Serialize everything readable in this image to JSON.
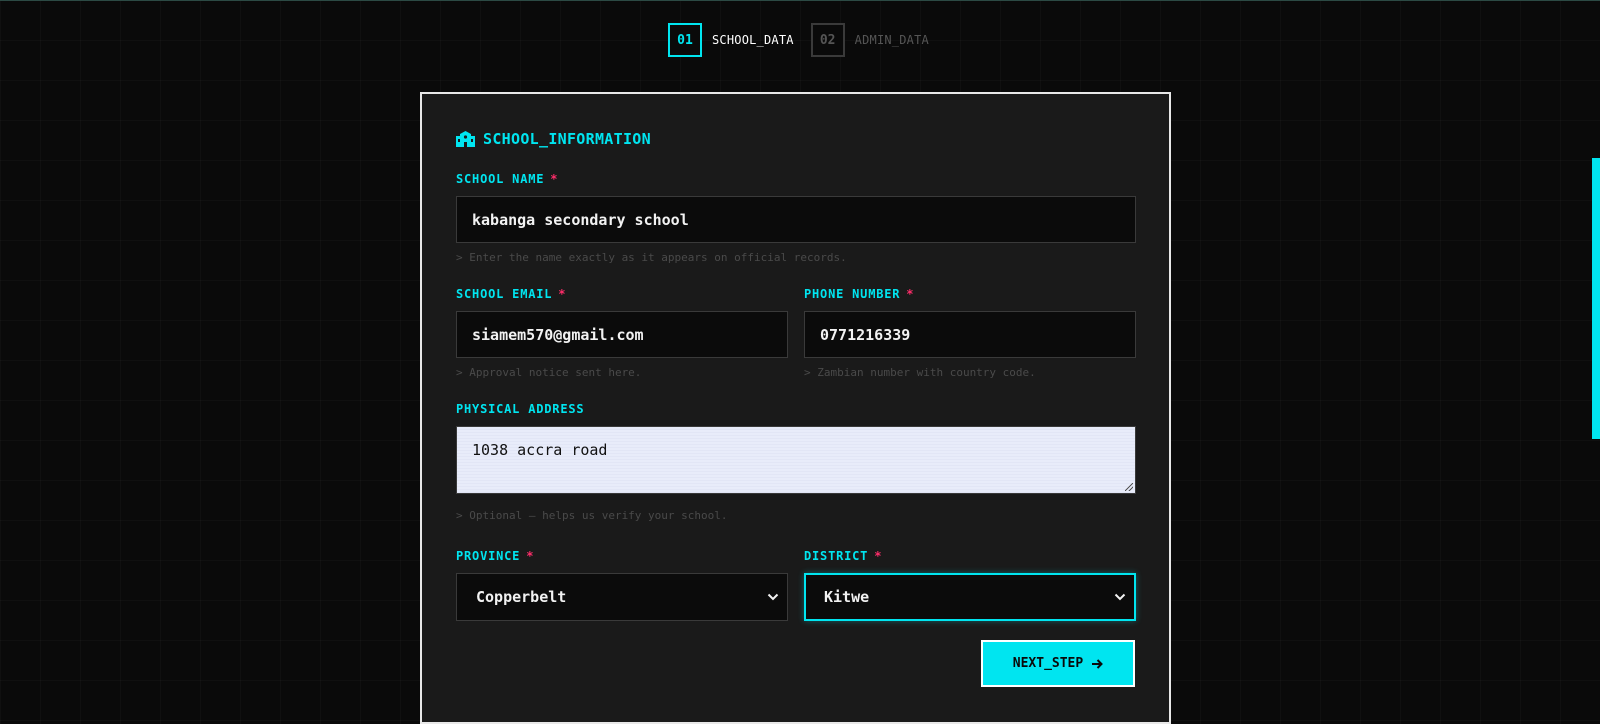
{
  "stepper": {
    "steps": [
      {
        "number": "01",
        "label": "SCHOOL_DATA",
        "state": "active"
      },
      {
        "number": "02",
        "label": "ADMIN_DATA",
        "state": "inactive"
      }
    ]
  },
  "form": {
    "section_title": "SCHOOL_INFORMATION",
    "section_icon": "school-icon",
    "required_marker": "*",
    "school_name": {
      "label": "SCHOOL NAME",
      "value": "kabanga secondary school",
      "hint": "> Enter the name exactly as it appears on official records."
    },
    "school_email": {
      "label": "SCHOOL EMAIL",
      "value": "siamem570@gmail.com",
      "hint": "> Approval notice sent here."
    },
    "phone_number": {
      "label": "PHONE NUMBER",
      "value": "0771216339",
      "hint": "> Zambian number with country code."
    },
    "physical_address": {
      "label": "PHYSICAL ADDRESS",
      "value": "1038 accra road",
      "hint": "> Optional — helps us verify your school."
    },
    "province": {
      "label": "PROVINCE",
      "selected": "Copperbelt"
    },
    "district": {
      "label": "DISTRICT",
      "selected": "Kitwe"
    },
    "next_button": {
      "label": "NEXT_STEP",
      "icon": "arrow-right-icon"
    }
  },
  "colors": {
    "accent": "#00e5f0",
    "required": "#ff2d6a",
    "background": "#0a0a0a",
    "card": "#1a1a1a"
  }
}
